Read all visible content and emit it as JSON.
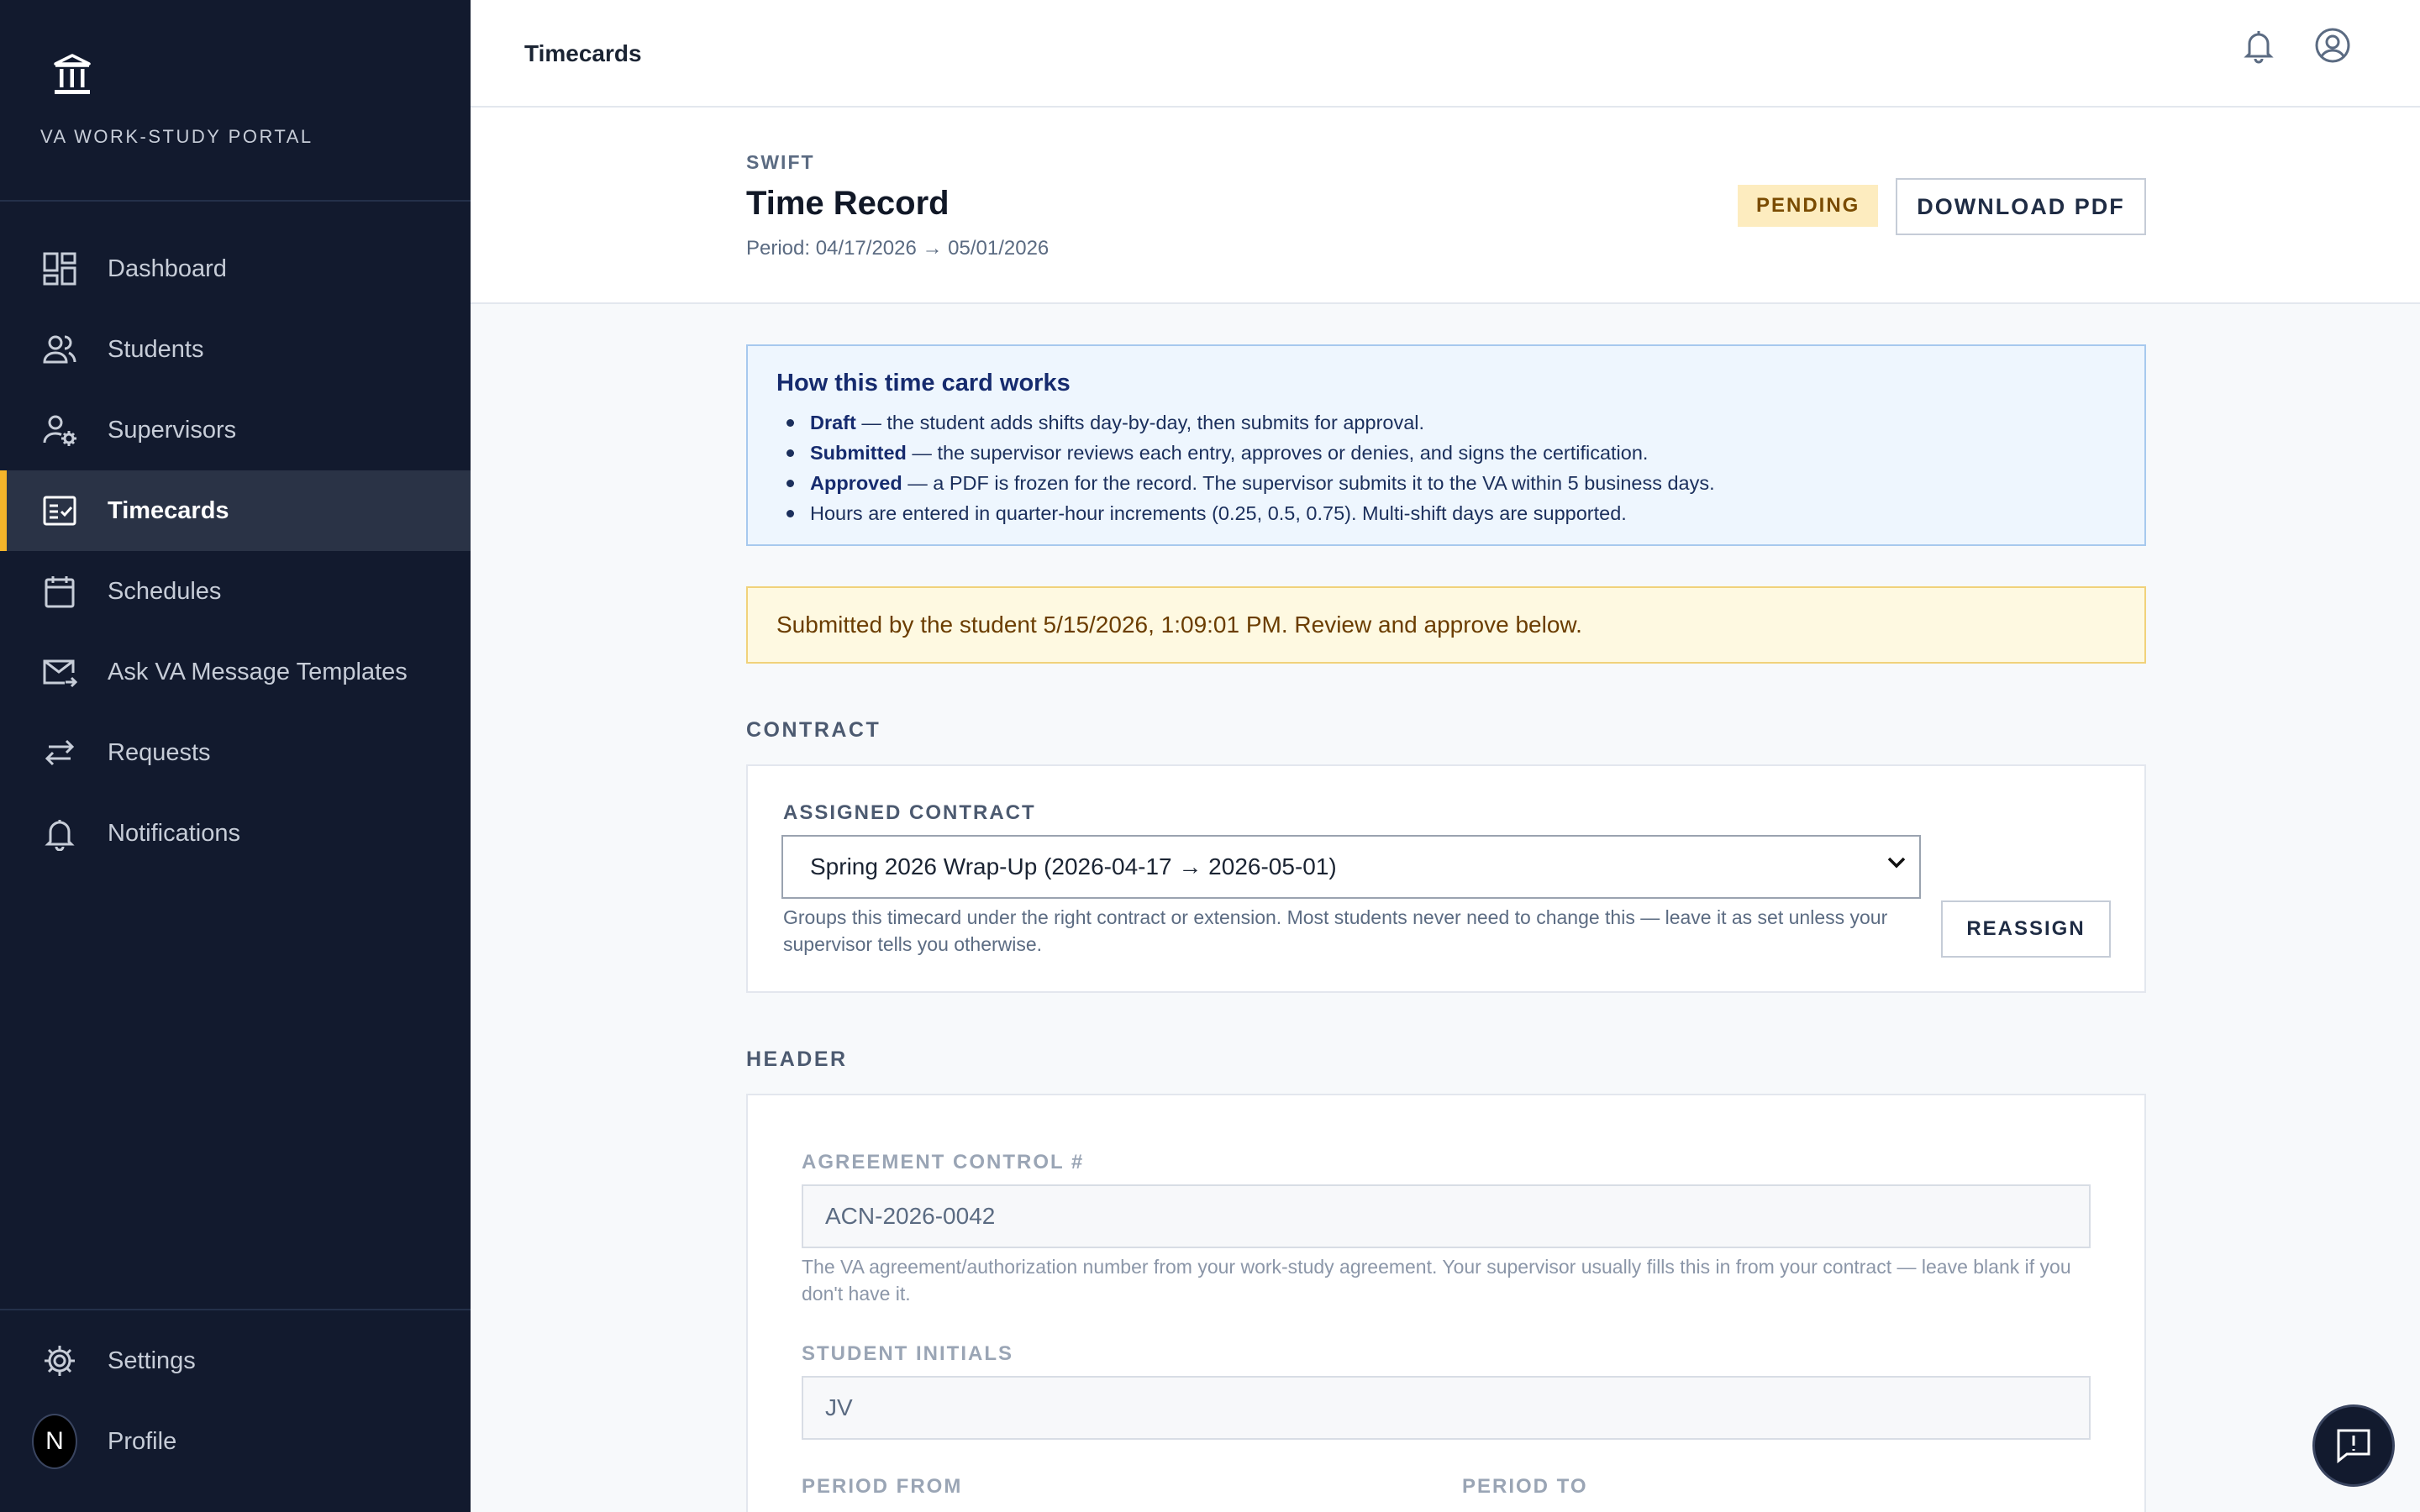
{
  "sidebar": {
    "brand": "VA WORK-STUDY PORTAL",
    "items": [
      {
        "label": "Dashboard",
        "icon": "dashboard-icon"
      },
      {
        "label": "Students",
        "icon": "students-icon"
      },
      {
        "label": "Supervisors",
        "icon": "supervisors-icon"
      },
      {
        "label": "Timecards",
        "icon": "timecards-icon",
        "active": true
      },
      {
        "label": "Schedules",
        "icon": "calendar-icon"
      },
      {
        "label": "Ask VA Message Templates",
        "icon": "mail-icon"
      },
      {
        "label": "Requests",
        "icon": "swap-arrows-icon"
      },
      {
        "label": "Notifications",
        "icon": "bell-icon"
      }
    ],
    "bottom": [
      {
        "label": "Settings",
        "icon": "gear-icon"
      },
      {
        "label": "Profile",
        "icon": "avatar"
      }
    ],
    "avatar_letter": "N"
  },
  "topbar": {
    "title": "Timecards"
  },
  "header": {
    "eyebrow": "SWIFT",
    "title": "Time Record",
    "period": "Period: 04/17/2026 → 05/01/2026",
    "status": "PENDING",
    "download_label": "DOWNLOAD PDF"
  },
  "info": {
    "title": "How this time card works",
    "items": [
      {
        "term": "Draft",
        "text": " — the student adds shifts day-by-day, then submits for approval."
      },
      {
        "term": "Submitted",
        "text": " — the supervisor reviews each entry, approves or denies, and signs the certification."
      },
      {
        "term": "Approved",
        "text": " — a PDF is frozen for the record. The supervisor submits it to the VA within 5 business days."
      },
      {
        "term": "",
        "text": "Hours are entered in quarter-hour increments (0.25, 0.5, 0.75). Multi-shift days are supported."
      }
    ]
  },
  "notice": "Submitted by the student 5/15/2026, 1:09:01 PM. Review and approve below.",
  "contract": {
    "section": "CONTRACT",
    "label": "ASSIGNED CONTRACT",
    "selected": "Spring 2026 Wrap-Up (2026-04-17 → 2026-05-01)",
    "help": "Groups this timecard under the right contract or extension. Most students never need to change this — leave it as set unless your supervisor tells you otherwise.",
    "reassign_label": "REASSIGN"
  },
  "header_section": {
    "section": "HEADER",
    "agreement_label": "AGREEMENT CONTROL #",
    "agreement_value": "ACN-2026-0042",
    "agreement_help": "The VA agreement/authorization number from your work-study agreement. Your supervisor usually fills this in from your contract — leave blank if you don't have it.",
    "initials_label": "STUDENT INITIALS",
    "initials_value": "JV",
    "period_from_label": "PERIOD FROM",
    "period_to_label": "PERIOD TO"
  },
  "colors": {
    "sidebar_bg": "#121a2e",
    "accent": "#f4b42a",
    "badge_bg": "#fdecbf",
    "info_bg": "#eef6fe",
    "notice_bg": "#fef9e1"
  }
}
